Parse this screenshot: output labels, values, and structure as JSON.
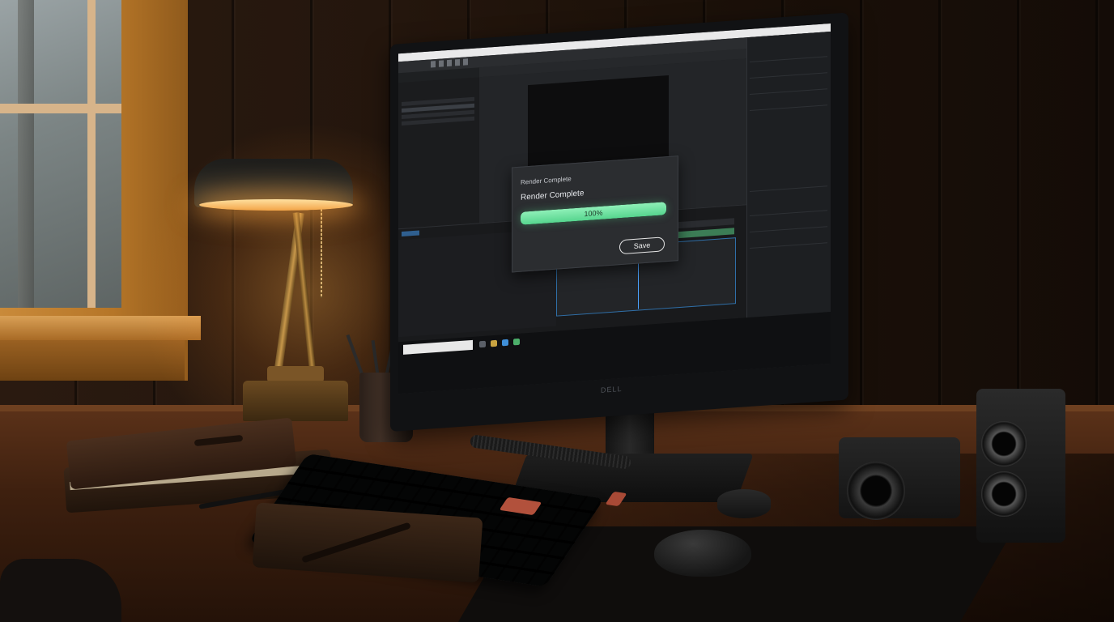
{
  "render_dialog": {
    "header": "Render Complete",
    "title": "Render Complete",
    "progress_percent": 100,
    "progress_label": "100%",
    "save_label": "Save"
  },
  "colors": {
    "progress_fill": "#56d58e",
    "dialog_bg": "#2b2d30",
    "lamp_light": "#f3a548",
    "playhead": "#4aa3ff"
  },
  "icons": [
    "search-icon",
    "folder-icon",
    "browser-icon",
    "app-icon"
  ]
}
